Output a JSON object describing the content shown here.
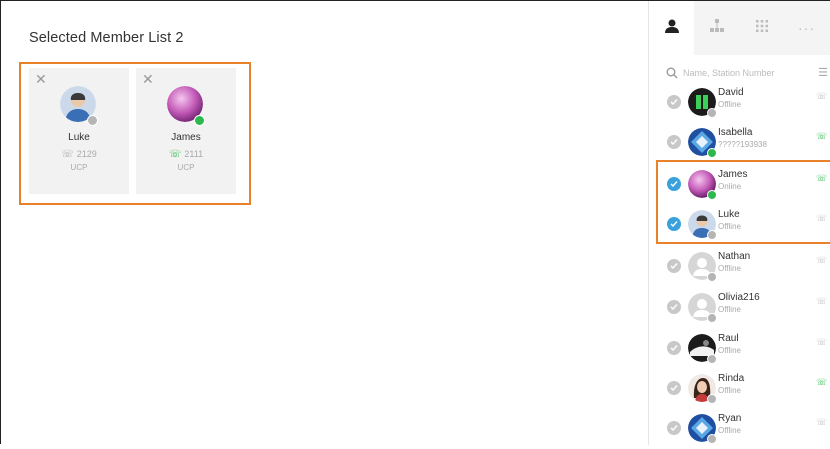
{
  "selected": {
    "title": "Selected Member List 2",
    "members": [
      {
        "name": "Luke",
        "ext": "2129",
        "device": "UCP",
        "status": "offline"
      },
      {
        "name": "James",
        "ext": "2111",
        "device": "UCP",
        "status": "online"
      }
    ]
  },
  "panel": {
    "tabs": [
      "person-icon",
      "org-chart-icon",
      "dialpad-icon",
      "more-icon"
    ],
    "search_placeholder": "Name, Station Number",
    "contacts": [
      {
        "name": "David",
        "sub": "Offline",
        "checked": false,
        "status": "offline",
        "call": "grey"
      },
      {
        "name": "Isabella",
        "sub": "?????193938",
        "checked": false,
        "status": "online",
        "call": "green"
      },
      {
        "name": "James",
        "sub": "Online",
        "checked": true,
        "status": "online",
        "call": "green"
      },
      {
        "name": "Luke",
        "sub": "Offline",
        "checked": true,
        "status": "offline",
        "call": "grey"
      },
      {
        "name": "Nathan",
        "sub": "Offline",
        "checked": false,
        "status": "offline",
        "call": "grey"
      },
      {
        "name": "Olivia216",
        "sub": "Offline",
        "checked": false,
        "status": "offline",
        "call": "grey"
      },
      {
        "name": "Raul",
        "sub": "Offline",
        "checked": false,
        "status": "offline",
        "call": "grey"
      },
      {
        "name": "Rinda",
        "sub": "Offline",
        "checked": false,
        "status": "offline",
        "call": "green"
      },
      {
        "name": "Ryan",
        "sub": "Offline",
        "checked": false,
        "status": "offline",
        "call": "grey"
      }
    ]
  },
  "colors": {
    "accent": "#3aa1dc",
    "highlight": "#e8822a",
    "online": "#2db84d",
    "offline": "#b5b5b5"
  }
}
